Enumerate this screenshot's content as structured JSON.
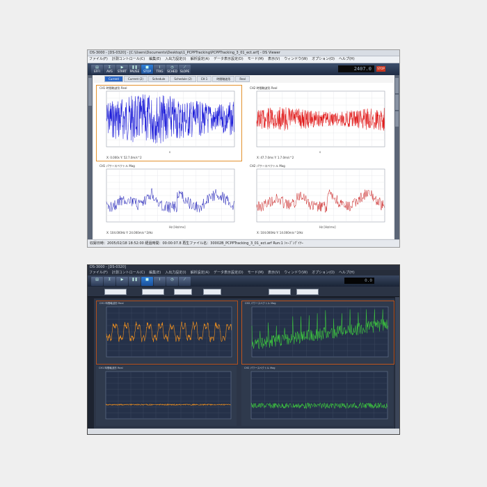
{
  "top_window": {
    "title": "DS-3000 - [DS-0320] - [C:\\Users\\Documents\\Desktop\\1_PCPPTracking\\PCPPTracking_3_01_ect.arf] - DS Viewer",
    "menu": [
      "ファイル(F)",
      "計測コントロール(C)",
      "編集(E)",
      "入出力設定(I)",
      "解析設定(A)",
      "データ表示設定(D)",
      "モード(M)",
      "表示(V)",
      "ウィンドウ(W)",
      "オプション(O)",
      "ヘルプ(H)"
    ],
    "toolbar": [
      {
        "label": "EFFI",
        "glyph": "▤"
      },
      {
        "label": "AVG",
        "glyph": "Σ"
      },
      {
        "label": "START",
        "glyph": "▶"
      },
      {
        "label": "PAUSE",
        "glyph": "❚❚"
      },
      {
        "label": "STOP",
        "glyph": "■"
      },
      {
        "label": "TRIG",
        "glyph": "⌇"
      },
      {
        "label": "SCHED",
        "glyph": "◷"
      },
      {
        "label": "SLOPE",
        "glyph": "⟋"
      }
    ],
    "counter": "2407.0",
    "stop_badge": "STOP",
    "tabs": [
      "Current",
      "Current (2)",
      "Schedule",
      "Schedule (2)",
      "CH 1",
      "時間軸波形",
      "Real"
    ],
    "active_tab": 0,
    "panels": [
      {
        "title": "CH1 時間軸波形 Real",
        "xlabel": "s",
        "readout": "X: 0.000s  Y: 52.7.0m/s^2",
        "color": "#1b1bd8"
      },
      {
        "title": "CH2 時間軸波形 Real",
        "xlabel": "s",
        "readout": "X: 47.7.0ms  Y: 1.7.0m/s^2",
        "color": "#e01818"
      },
      {
        "title": "CH1 パワースペクトル Mag",
        "xlabel": "Hz  [Hz/rms]",
        "readout": "X: 104.000Hz  Y: 24.000m/s^2/Hz",
        "color": "#2020b8"
      },
      {
        "title": "CH2 パワースペクトル Mag",
        "xlabel": "Hz  [Hz/rms]",
        "readout": "X: 104.000Hz  Y: 14.000m/s^2/Hz",
        "color": "#c81a1a"
      }
    ],
    "status": "収録日時：2005/02/18 18:52:00   経過時間：00:00:07.8   再生ファイル名：30002B_PCPPTracking_3_01_ect.arf   Run:1  ｼｬｰﾌﾟﾝｸﾞｲﾅｰ"
  },
  "bottom_window": {
    "title": "DS-3000 - [DS-0320]",
    "menu": [
      "ファイル(F)",
      "計測コントロール(C)",
      "編集(E)",
      "入出力設定(I)",
      "解析設定(A)",
      "データ表示設定(D)",
      "モード(M)",
      "表示(V)",
      "ウィンドウ(W)",
      "オプション(O)",
      "ヘルプ(H)"
    ],
    "counter": "0.0",
    "panels": [
      {
        "title": "CH1 時間軸波形 Real",
        "color": "#f0901e"
      },
      {
        "title": "CH2 パワースペクトル Mag",
        "color": "#3ecf3e"
      },
      {
        "title": "CH1 時間軸波形 Real",
        "color": "#f0901e"
      },
      {
        "title": "CH2 パワースペクトル Mag",
        "color": "#3ecf3e"
      }
    ]
  },
  "colors": {
    "blue": "#1b1bd8",
    "red": "#e01818",
    "orange": "#f0901e",
    "green": "#3ecf3e",
    "selected_border": "#e3902c"
  }
}
